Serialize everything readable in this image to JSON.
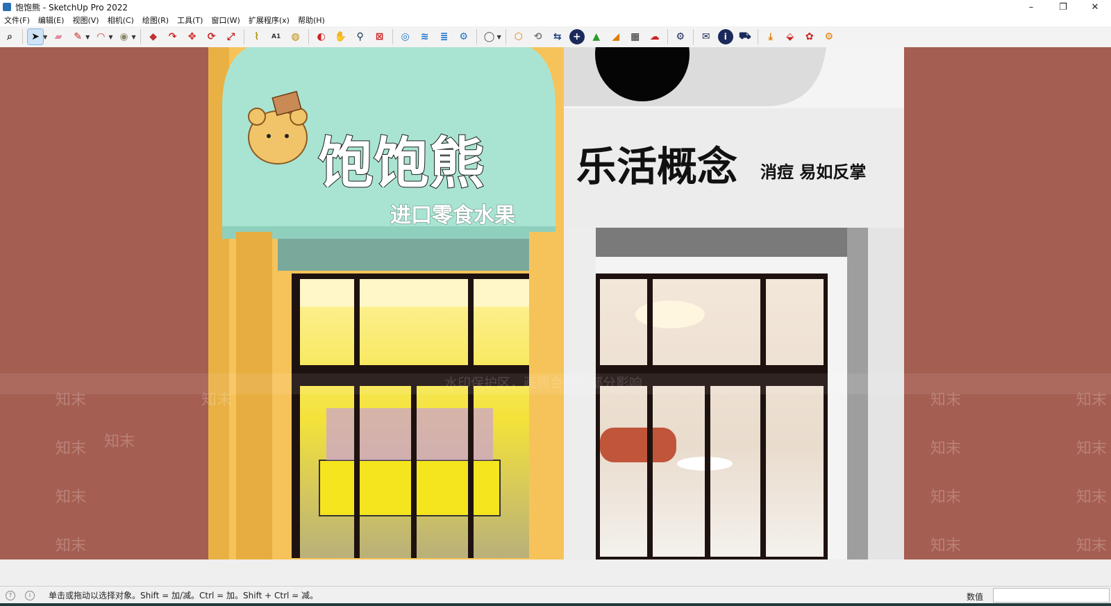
{
  "window": {
    "title": "饱饱熊 - SketchUp Pro 2022",
    "controls": [
      "–",
      "❐",
      "✕"
    ]
  },
  "menu": {
    "items": [
      "文件(F)",
      "编辑(E)",
      "视图(V)",
      "相机(C)",
      "绘图(R)",
      "工具(T)",
      "窗口(W)",
      "扩展程序(x)",
      "帮助(H)"
    ]
  },
  "toolbar": {
    "icons": [
      "zoom-extents-icon",
      "select-icon",
      "eraser-icon",
      "line-icon",
      "arc-icon",
      "shape-icon",
      "push-pull-icon",
      "follow-me-icon",
      "move-icon",
      "rotate-icon",
      "scale-icon",
      "tape-measure-icon",
      "text-icon",
      "paint-bucket-icon",
      "orbit-icon",
      "pan-icon",
      "zoom-icon",
      "zoom-window-icon",
      "section-icon",
      "layers-icon",
      "styles-icon",
      "components-icon",
      "user-icon",
      "warehouse-icon",
      "refresh-icon",
      "send-icon",
      "add-icon",
      "tree-icon",
      "chart-icon",
      "checker-icon",
      "cloud-icon",
      "settings-icon",
      "mail-icon",
      "info-icon",
      "cart-icon",
      "extension-icon",
      "extension-icon-2",
      "extension-icon-3",
      "extension-icon-4"
    ],
    "accent": "#1a73c8"
  },
  "scene": {
    "shop_left": {
      "name": "饱饱熊",
      "subtitle": "进口零食水果",
      "sign_color": "#a9e4d3",
      "frame_color": "#f6c35a"
    },
    "shop_right": {
      "name": "乐活概念",
      "slogan": "消痘 易如反掌",
      "sign_color": "#ececec"
    },
    "watermark_banner": "水印保护区，画质会受到部分影响",
    "watermark_mark": "知末",
    "wall_color": "#a55e52"
  },
  "status": {
    "hint": "单击或拖动以选择对象。Shift = 加/减。Ctrl = 加。Shift + Ctrl = 减。",
    "measure_label": "数值",
    "measure_value": ""
  }
}
